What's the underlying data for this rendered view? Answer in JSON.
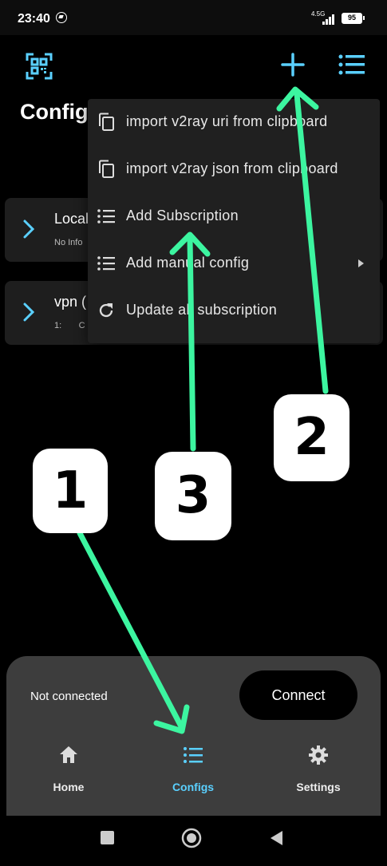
{
  "status_bar": {
    "time": "23:40",
    "network": "4.5G",
    "battery": "95"
  },
  "header": {
    "title": "Configs"
  },
  "configs": [
    {
      "name": "Local",
      "info": "No Info"
    },
    {
      "name": "vpn (",
      "info": "1:       C"
    }
  ],
  "popup_menu": {
    "items": [
      {
        "label": "import v2ray uri from clipboard",
        "icon": "copy-icon"
      },
      {
        "label": "import v2ray json from clipboard",
        "icon": "copy-icon"
      },
      {
        "label": "Add Subscription",
        "icon": "list-icon"
      },
      {
        "label": "Add manual config",
        "icon": "list-icon",
        "has_submenu": true
      },
      {
        "label": "Update all subscription",
        "icon": "refresh-icon"
      }
    ]
  },
  "bottom": {
    "status": "Not connected",
    "connect_label": "Connect",
    "nav": [
      {
        "label": "Home",
        "icon": "home-icon",
        "active": false
      },
      {
        "label": "Configs",
        "icon": "list-icon",
        "active": true
      },
      {
        "label": "Settings",
        "icon": "gear-icon",
        "active": false
      }
    ]
  },
  "annotations": {
    "badges": [
      "1",
      "2",
      "3"
    ]
  },
  "colors": {
    "accent": "#5ad0ff",
    "arrow": "#3cf5a0",
    "background": "#000000",
    "panel": "#3d3d3d",
    "menu": "#202020"
  }
}
